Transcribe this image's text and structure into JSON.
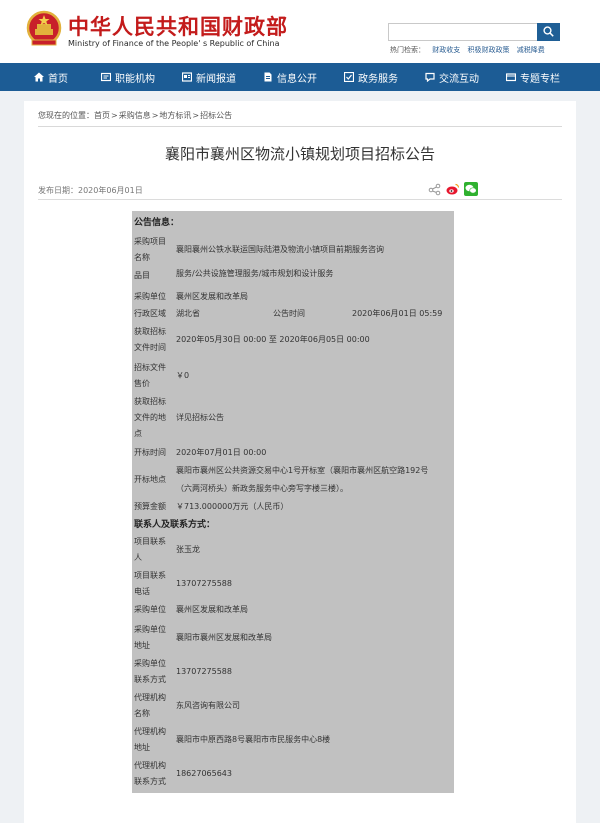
{
  "site": {
    "name_cn": "中华人民共和国财政部",
    "name_en": "Ministry of Finance of the People' s Republic of China"
  },
  "search": {
    "placeholder": "",
    "hot_label": "热门检索：",
    "hot_links": [
      "财政收支",
      "积极财政政策",
      "减税降费"
    ]
  },
  "nav": [
    {
      "label": "首页",
      "icon": "home-icon"
    },
    {
      "label": "职能机构",
      "icon": "org-icon"
    },
    {
      "label": "新闻报道",
      "icon": "news-icon"
    },
    {
      "label": "信息公开",
      "icon": "doc-icon"
    },
    {
      "label": "政务服务",
      "icon": "service-icon"
    },
    {
      "label": "交流互动",
      "icon": "chat-icon"
    },
    {
      "label": "专题专栏",
      "icon": "topic-icon"
    }
  ],
  "breadcrumb": {
    "prefix": "您现在的位置：",
    "items": [
      "首页",
      "采购信息",
      "地方标讯",
      "招标公告"
    ],
    "sep": ">"
  },
  "article": {
    "title": "襄阳市襄州区物流小镇规划项目招标公告",
    "pub_date": "发布日期：2020年06月01日"
  },
  "notice": {
    "section1": "公告信息：",
    "project_name_label": [
      "采购项目",
      "名称"
    ],
    "project_name": "襄阳襄州公铁水联运国际陆港及物流小镇项目前期服务咨询",
    "category_label": "品目",
    "category": "服务/公共设施管理服务/城市规划和设计服务",
    "buyer_label": "采购单位",
    "buyer": "襄州区发展和改革局",
    "region_label": "行政区域",
    "region": "湖北省",
    "announce_time_label": "公告时间",
    "announce_time": "2020年06月01日  05:59",
    "get_time_label": [
      "获取招标",
      "文件时间"
    ],
    "get_time": "2020年05月30日 00:00  至  2020年06月05日 00:00",
    "price_label": [
      "招标文件",
      "售价"
    ],
    "price": "￥0",
    "get_place_label": [
      "获取招标",
      "文件的地",
      "点"
    ],
    "get_place": "详见招标公告",
    "open_time_label": "开标时间",
    "open_time": "2020年07月01日 00:00",
    "open_place_label": "开标地点",
    "open_place": [
      "襄阳市襄州区公共资源交易中心1号开标室（襄阳市襄州区航空路192号",
      "（六两河桥头）新政务服务中心旁写字楼三楼）。"
    ],
    "budget_label": "预算金额",
    "budget": "￥713.000000万元（人民币）",
    "section2": "联系人及联系方式：",
    "contact_label": [
      "项目联系",
      "人"
    ],
    "contact": "张玉龙",
    "contact_phone_label": [
      "项目联系",
      "电话"
    ],
    "contact_phone": "13707275588",
    "buyer2_label": "采购单位",
    "buyer2": "襄州区发展和改革局",
    "buyer_addr_label": [
      "采购单位",
      "地址"
    ],
    "buyer_addr": "襄阳市襄州区发展和改革局",
    "buyer_phone_label": [
      "采购单位",
      "联系方式"
    ],
    "buyer_phone": "13707275588",
    "agency_label": [
      "代理机构",
      "名称"
    ],
    "agency": "东风咨询有限公司",
    "agency_addr_label": [
      "代理机构",
      "地址"
    ],
    "agency_addr": "襄阳市中原西路8号襄阳市市民服务中心8楼",
    "agency_phone_label": [
      "代理机构",
      "联系方式"
    ],
    "agency_phone": "18627065643"
  },
  "colors": {
    "brand_red": "#c31b1b",
    "nav_blue": "#1c5c95",
    "notice_gray": "#c1c1c1"
  }
}
